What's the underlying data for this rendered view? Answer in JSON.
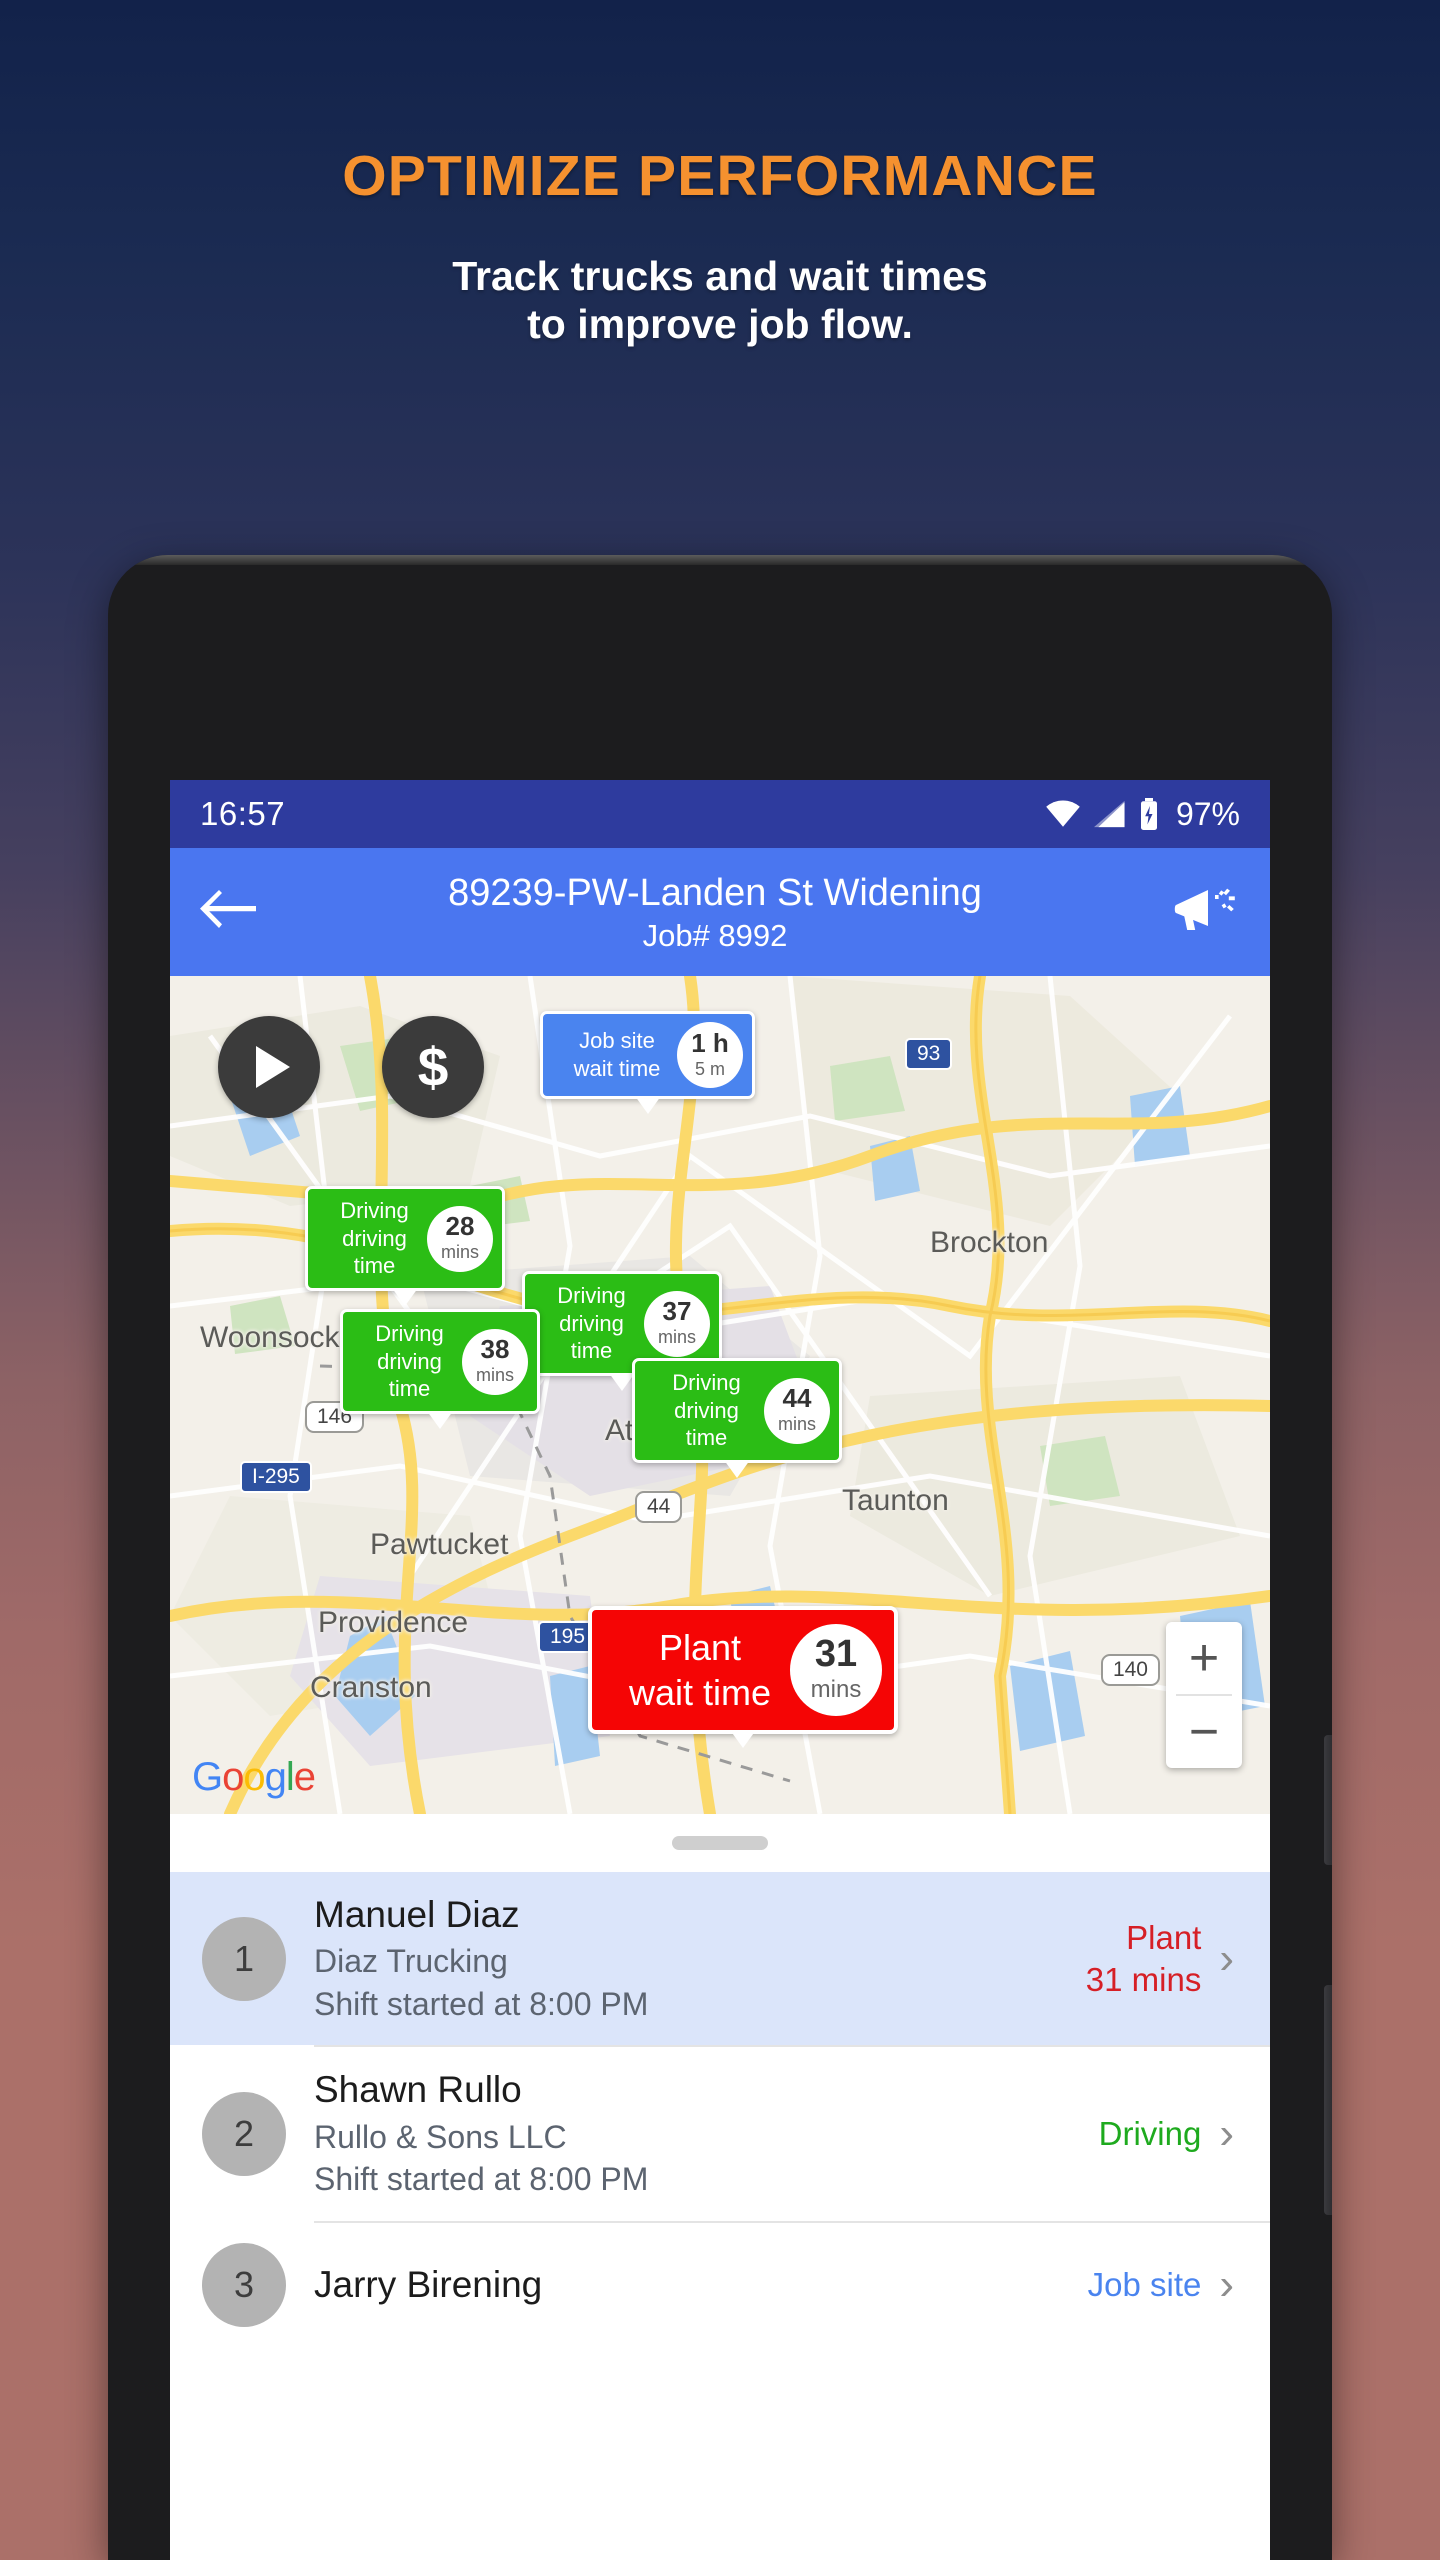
{
  "promo": {
    "title": "OPTIMIZE PERFORMANCE",
    "subtitle_line1": "Track trucks and wait times",
    "subtitle_line2": "to improve job flow.",
    "title_color": "#f5912f",
    "subtitle_color": "#ffffff"
  },
  "status_bar": {
    "time": "16:57",
    "battery": "97%",
    "icons": [
      "wifi-icon",
      "signal-icon",
      "battery-icon"
    ]
  },
  "app_bar": {
    "back_icon": "back-arrow-icon",
    "title": "89239-PW-Landen St Widening",
    "subtitle": "Job# 8992",
    "action_icon": "megaphone-icon",
    "background": "#4a76f0"
  },
  "map": {
    "play_button_icon": "play-icon",
    "money_button_icon": "dollar-icon",
    "zoom_in": "+",
    "zoom_out": "−",
    "attribution": "Google",
    "labels": [
      {
        "text": "Brockton"
      },
      {
        "text": "Woonsocket"
      },
      {
        "text": "Attleboro"
      },
      {
        "text": "Taunton"
      },
      {
        "text": "Pawtucket"
      },
      {
        "text": "Providence"
      },
      {
        "text": "Cranston"
      }
    ],
    "shields": [
      {
        "text": "93"
      },
      {
        "text": "146"
      },
      {
        "text": "I-295"
      },
      {
        "text": "44"
      },
      {
        "text": "195"
      },
      {
        "text": "140"
      }
    ],
    "markers": [
      {
        "line1": "Job site",
        "line2": "wait time",
        "value": "1 h",
        "unit": "5 m",
        "color": "#4a84ef",
        "type": "job-site"
      },
      {
        "line1": "Driving",
        "line2": "driving time",
        "value": "28",
        "unit": "mins",
        "color": "#2bbd15",
        "type": "driving"
      },
      {
        "line1": "Driving",
        "line2": "driving time",
        "value": "37",
        "unit": "mins",
        "color": "#2bbd15",
        "type": "driving"
      },
      {
        "line1": "Driving",
        "line2": "driving time",
        "value": "38",
        "unit": "mins",
        "color": "#2bbd15",
        "type": "driving"
      },
      {
        "line1": "Driving",
        "line2": "driving time",
        "value": "44",
        "unit": "mins",
        "color": "#2bbd15",
        "type": "driving"
      },
      {
        "line1": "Plant",
        "line2": "wait time",
        "value": "31",
        "unit": "mins",
        "color": "#f50505",
        "type": "plant"
      }
    ]
  },
  "driver_list": [
    {
      "index": "1",
      "name": "Manuel Diaz",
      "company": "Diaz Trucking",
      "shift": "Shift started at 8:00 PM",
      "status_line1": "Plant",
      "status_line2": "31 mins",
      "status_color": "#d61f26",
      "selected": true
    },
    {
      "index": "2",
      "name": "Shawn Rullo",
      "company": "Rullo & Sons LLC",
      "shift": "Shift started at 8:00 PM",
      "status_line1": "Driving",
      "status_line2": "",
      "status_color": "#1eaa1e",
      "selected": false
    },
    {
      "index": "3",
      "name": "Jarry Birening",
      "company": "",
      "shift": "",
      "status_line1": "Job site",
      "status_line2": "",
      "status_color": "#4a84ef",
      "selected": false
    }
  ]
}
